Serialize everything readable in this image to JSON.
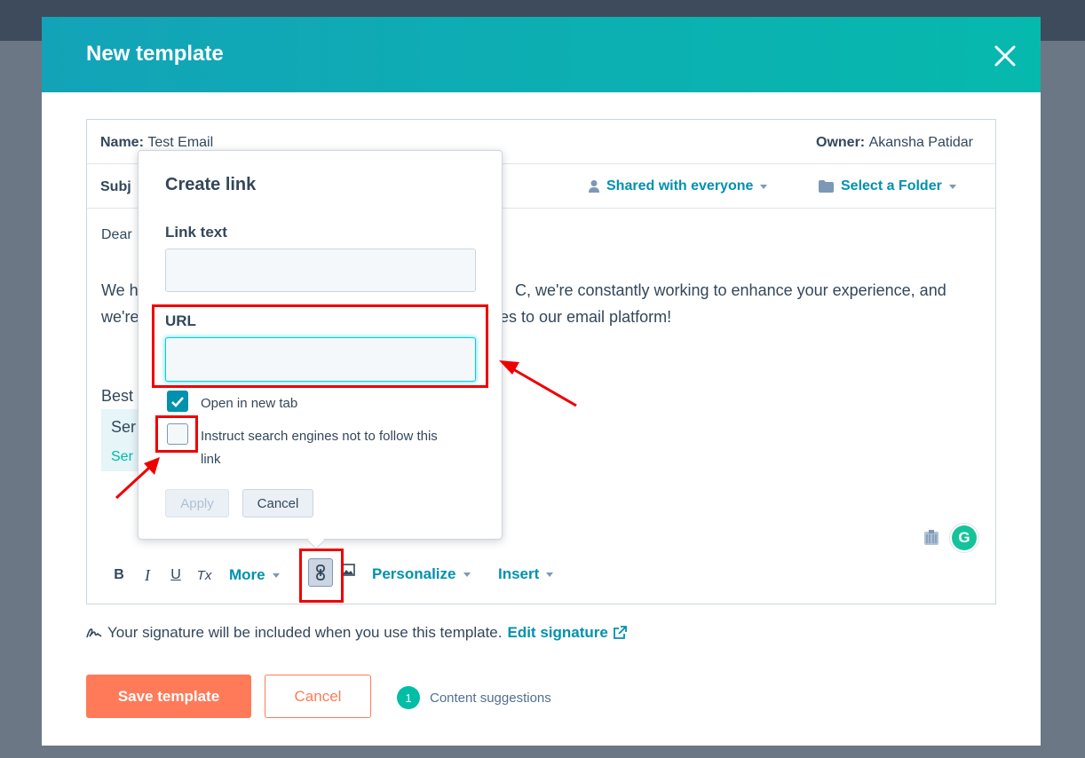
{
  "modal": {
    "title": "New template",
    "name_label": "Name:",
    "name_value": "Test Email",
    "owner_label": "Owner:",
    "owner_value": "Akansha Patidar",
    "subject_label_partial": "Subj",
    "shared_label": "Shared with everyone",
    "folder_label": "Select a Folder"
  },
  "editor": {
    "line_dear": "Dear",
    "line_we_h": "We h",
    "line_were": "we're",
    "line_right1": "C, we're constantly working to enhance your experience, and",
    "line_right2": "es to our email platform!",
    "line_best": "Best",
    "sig_name_partial": "Ser",
    "sig_role_partial": "Ser"
  },
  "toolbar": {
    "bold": "B",
    "italic": "I",
    "underline": "U",
    "clear_format": "Tx",
    "more_label": "More",
    "personalize_label": "Personalize",
    "insert_label": "Insert"
  },
  "popover": {
    "title": "Create link",
    "link_text_label": "Link text",
    "link_text_value": "",
    "url_label": "URL",
    "url_value": "",
    "open_new_tab_label": "Open in new tab",
    "open_new_tab_checked": true,
    "nofollow_label_line1": "Instruct search engines not to follow this",
    "nofollow_label_line2": "link",
    "nofollow_checked": false,
    "apply_label": "Apply",
    "cancel_label": "Cancel"
  },
  "footer": {
    "signature_note": "Your signature will be included when you use this template.",
    "edit_signature_label": "Edit signature",
    "save_label": "Save template",
    "cancel_label": "Cancel",
    "suggestions_count": "1",
    "suggestions_label": "Content suggestions"
  },
  "colors": {
    "header_gradient_start": "#13a3b8",
    "header_gradient_end": "#06b9ad",
    "link_blue": "#0091ae",
    "primary_orange": "#ff7a59",
    "annotation_red": "#ee0000"
  },
  "icons": [
    "close-icon",
    "user-icon",
    "folder-icon",
    "caret-down-icon",
    "link-icon",
    "image-icon",
    "grammarly-icon",
    "extension-icon",
    "signature-icon",
    "external-link-icon",
    "checkmark-icon"
  ]
}
